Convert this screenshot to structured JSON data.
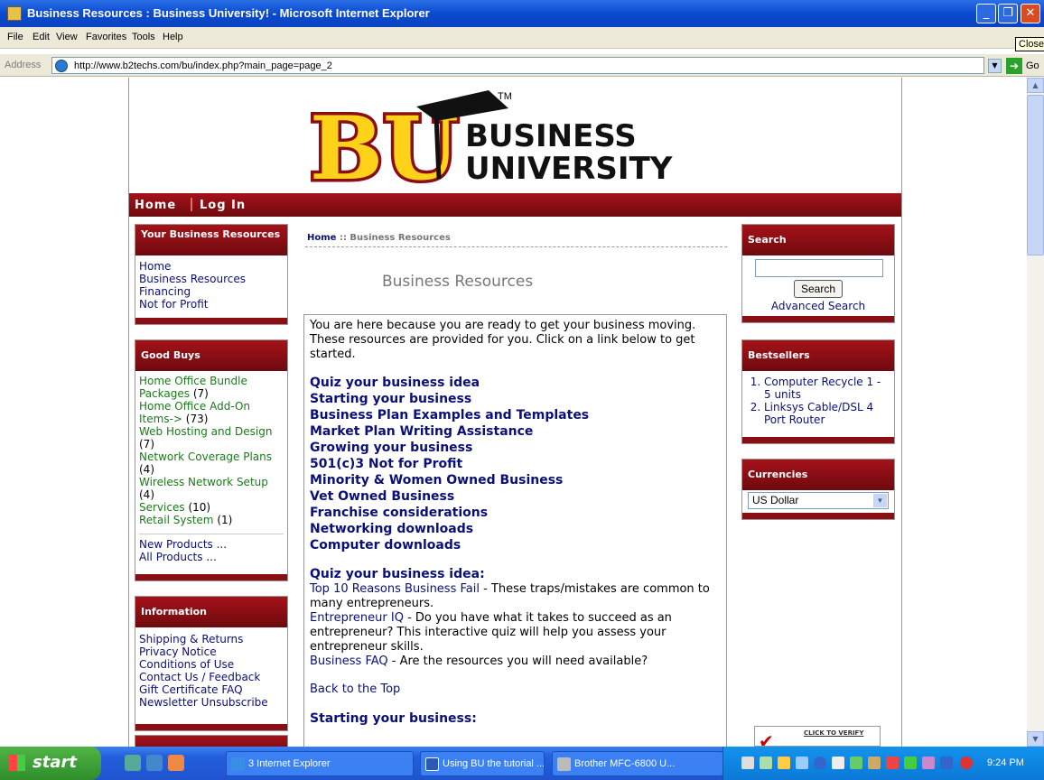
{
  "window": {
    "title": "Business Resources : Business University! - Microsoft Internet Explorer",
    "min": "_",
    "max": "❐",
    "close": "✕"
  },
  "menu": [
    "File",
    "Edit",
    "View",
    "Favorites",
    "Tools",
    "Help"
  ],
  "tooltip": "Close",
  "address": {
    "label": "Address",
    "url": "http://www.b2techs.com/bu/index.php?main_page=page_2",
    "go": "Go"
  },
  "logo": {
    "letters": "BU",
    "tm": "TM",
    "line1": "BUSINESS",
    "line2": "UNIVERSITY"
  },
  "nav": {
    "home": "Home",
    "login": "Log In"
  },
  "left": {
    "resources": {
      "title": "Your Business Resources",
      "items": [
        "Home",
        "Business Resources",
        "Financing",
        "Not for Profit"
      ]
    },
    "goodbuys": {
      "title": "Good Buys",
      "items": [
        {
          "label": "Home Office Bundle Packages",
          "count": "(7)"
        },
        {
          "label": "Home Office Add-On Items->",
          "count": "(73)"
        },
        {
          "label": "Web Hosting and Design",
          "count": "(7)"
        },
        {
          "label": "Network Coverage Plans",
          "count": "(4)"
        },
        {
          "label": "Wireless Network Setup",
          "count": "(4)"
        },
        {
          "label": "Services",
          "count": "(10)"
        },
        {
          "label": "Retail System",
          "count": "(1)"
        }
      ],
      "new": "New Products ...",
      "all": "All Products ..."
    },
    "info": {
      "title": "Information",
      "items": [
        "Shipping & Returns",
        "Privacy Notice",
        "Conditions of Use",
        "Contact Us / Feedback",
        "Gift Certificate FAQ",
        "Newsletter Unsubscribe"
      ]
    }
  },
  "breadcrumb": {
    "home": "Home",
    "sep": " :: ",
    "current": "Business Resources"
  },
  "main": {
    "title": "Business Resources",
    "intro": "You are here because you are ready to get your business moving. These resources are provided for you. Click on a link below to get started.",
    "links": [
      "Quiz your business idea",
      "Starting your business",
      "Business Plan Examples and Templates",
      "Market Plan Writing Assistance",
      "Growing your business",
      "501(c)3 Not for Profit",
      "Minority & Women Owned Business",
      "Vet Owned Business",
      "Franchise considerations",
      "Networking downloads",
      "Computer downloads"
    ],
    "section1": "Quiz your business idea:",
    "s1_link1": "Top 10 Reasons Business Fail",
    "s1_text1": " - These traps/mistakes are common to many entrepreneurs.",
    "s1_link2": "Entrepreneur IQ",
    "s1_text2": " - Do you have what it takes to succeed as an entrepreneur? This interactive quiz will help you assess your entrepreneur skills.",
    "s1_link3": "Business FAQ",
    "s1_text3": " - Are the resources you will need available?",
    "back": "Back to the Top",
    "section2": "Starting your business:"
  },
  "right": {
    "search": {
      "title": "Search",
      "button": "Search",
      "advanced": "Advanced Search"
    },
    "bestsellers": {
      "title": "Bestsellers",
      "items": [
        "Computer Recycle 1 - 5 units",
        "Linksys Cable/DSL 4 Port Router"
      ]
    },
    "currencies": {
      "title": "Currencies",
      "selected": "US Dollar"
    },
    "verify": "CLICK TO VERIFY"
  },
  "taskbar": {
    "start": "start",
    "tasks": [
      "3 Internet Explorer",
      "Using BU the tutorial ...",
      "Brother MFC-6800 U..."
    ],
    "clock": "9:24 PM"
  }
}
